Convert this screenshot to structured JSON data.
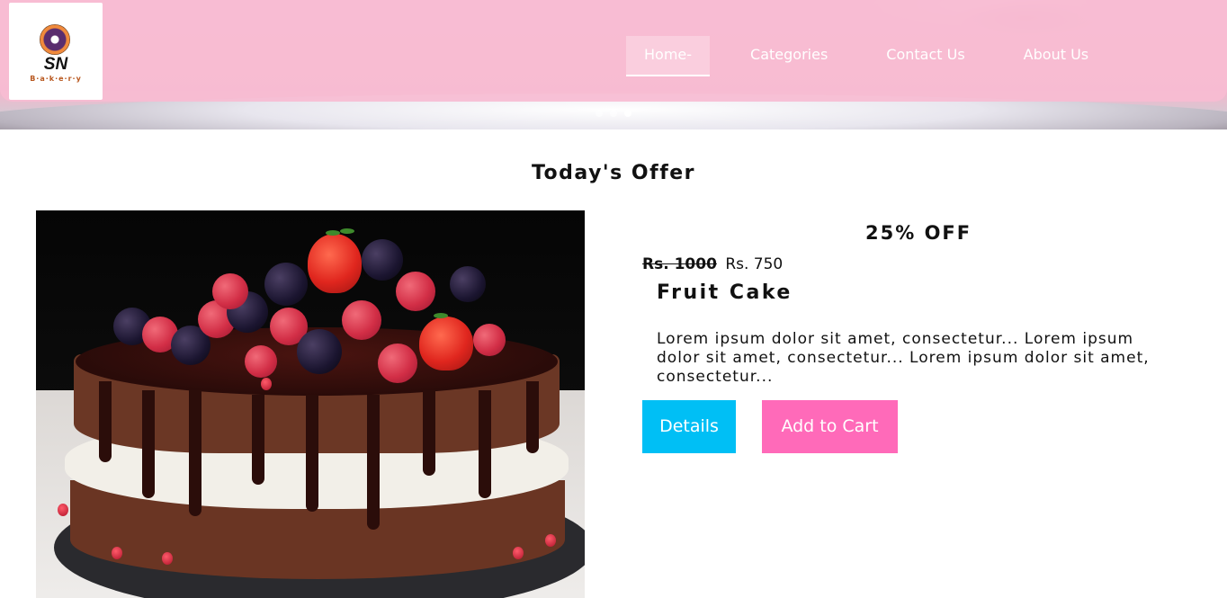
{
  "brand": {
    "logo_initials": "SN",
    "logo_subtitle": "B·a·k·e·r·y"
  },
  "nav": {
    "items": [
      {
        "label": "Home-",
        "active": true
      },
      {
        "label": "Categories",
        "active": false
      },
      {
        "label": "Contact Us",
        "active": false
      },
      {
        "label": "About Us",
        "active": false
      }
    ]
  },
  "carousel": {
    "slide_count": 3,
    "active_slide": 3
  },
  "section": {
    "title": "Today's Offer"
  },
  "offer": {
    "discount": "25% OFF",
    "old_price": "Rs. 1000",
    "new_price": "Rs. 750",
    "product_name": "Fruit Cake",
    "description": "Lorem ipsum dolor sit amet, consectetur... Lorem ipsum dolor sit amet, consectetur... Lorem ipsum dolor sit amet, consectetur...",
    "details_label": "Details",
    "cart_label": "Add to Cart"
  },
  "colors": {
    "nav_bg": "#f7bcd2",
    "details_button": "#00bff5",
    "cart_button": "#ff6ab9"
  }
}
